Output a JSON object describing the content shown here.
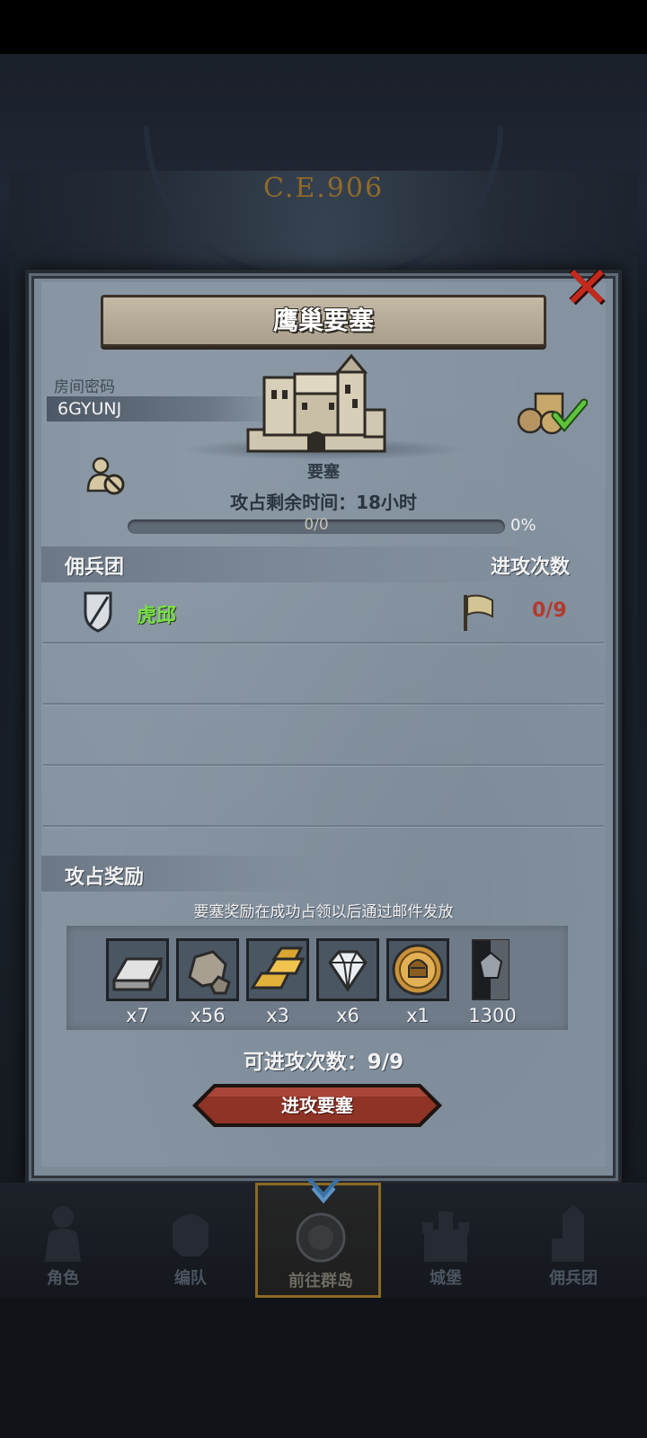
{
  "background": {
    "era_text": "C.E.906"
  },
  "dialog": {
    "title": "鹰巢要塞",
    "close_icon": "close-x-icon",
    "room_label": "房间密码",
    "room_code": "6GYUNJ",
    "fortress_label": "要塞",
    "remaining_time": "攻占剩余时间：18小时",
    "progress": {
      "text": "0/0",
      "percent": "0%",
      "fraction": 0
    }
  },
  "mercenary_section": {
    "title": "佣兵团",
    "attacks_title": "进攻次数",
    "rows": [
      {
        "name": "虎邱",
        "count": "0/9"
      }
    ]
  },
  "reward_section": {
    "title": "攻占奖励",
    "note": "要塞奖励在成功占领以后通过邮件发放",
    "items": [
      {
        "icon": "silver-ingot-icon",
        "qty": "x7"
      },
      {
        "icon": "stone-ore-icon",
        "qty": "x56"
      },
      {
        "icon": "gold-bars-icon",
        "qty": "x3"
      },
      {
        "icon": "diamond-icon",
        "qty": "x6"
      },
      {
        "icon": "knight-coin-icon",
        "qty": "x1"
      },
      {
        "icon": "banner-icon",
        "qty": "1300"
      }
    ]
  },
  "attempts": "可进攻次数：9/9",
  "attack_button": "进攻要塞",
  "bottom_nav": [
    {
      "label": "角色",
      "icon": "knight-icon"
    },
    {
      "label": "编队",
      "icon": "helmet-icon"
    },
    {
      "label": "前往群岛",
      "icon": "compass-icon",
      "active": true
    },
    {
      "label": "城堡",
      "icon": "castle-icon"
    },
    {
      "label": "佣兵团",
      "icon": "tower-icon"
    }
  ]
}
